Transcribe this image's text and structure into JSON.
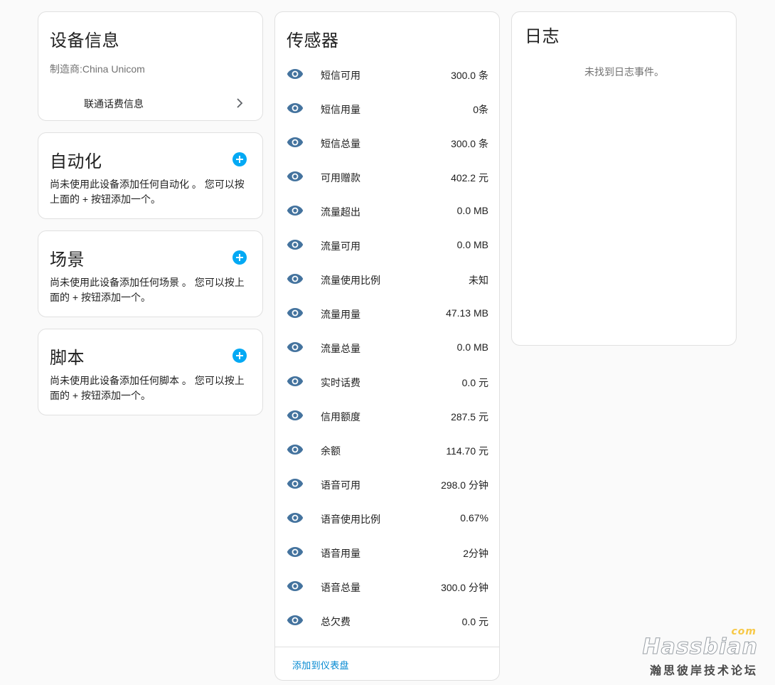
{
  "device_info": {
    "title": "设备信息",
    "manufacturer_label": "制造商:",
    "manufacturer_value": "China Unicom",
    "link_label": "联通话费信息"
  },
  "automation": {
    "title": "自动化",
    "message_line1": "尚未使用此设备添加任何自动化 。 您可以按",
    "message_line2": "上面的 + 按钮添加一个。"
  },
  "scene": {
    "title": "场景",
    "message_line1": "尚未使用此设备添加任何场景 。 您可以按上",
    "message_line2": "面的 + 按钮添加一个。"
  },
  "script": {
    "title": "脚本",
    "message_line1": "尚未使用此设备添加任何脚本 。 您可以按上",
    "message_line2": "面的 + 按钮添加一个。"
  },
  "sensors": {
    "title": "传感器",
    "icon": "eye-icon",
    "items": [
      {
        "name": "短信可用",
        "value": "300.0 条"
      },
      {
        "name": "短信用量",
        "value": "0条"
      },
      {
        "name": "短信总量",
        "value": "300.0 条"
      },
      {
        "name": "可用赠款",
        "value": "402.2 元"
      },
      {
        "name": "流量超出",
        "value": "0.0 MB"
      },
      {
        "name": "流量可用",
        "value": "0.0 MB"
      },
      {
        "name": "流量使用比例",
        "value": "未知"
      },
      {
        "name": "流量用量",
        "value": "47.13 MB"
      },
      {
        "name": "流量总量",
        "value": "0.0 MB"
      },
      {
        "name": "实时话费",
        "value": "0.0 元"
      },
      {
        "name": "信用额度",
        "value": "287.5 元"
      },
      {
        "name": "余额",
        "value": "114.70 元"
      },
      {
        "name": "语音可用",
        "value": "298.0 分钟"
      },
      {
        "name": "语音使用比例",
        "value": "0.67%"
      },
      {
        "name": "语音用量",
        "value": "2分钟"
      },
      {
        "name": "语音总量",
        "value": "300.0 分钟"
      },
      {
        "name": "总欠费",
        "value": "0.0 元"
      }
    ],
    "action_label": "添加到仪表盘"
  },
  "logbook": {
    "title": "日志",
    "empty_message": "未找到日志事件。"
  },
  "watermark": {
    "brand": "Hassbian",
    "suffix": "com",
    "tagline": "瀚思彼岸技术论坛"
  },
  "colors": {
    "accent": "#03a9f4",
    "eye_icon": "#44739e",
    "link": "#0288d1"
  }
}
